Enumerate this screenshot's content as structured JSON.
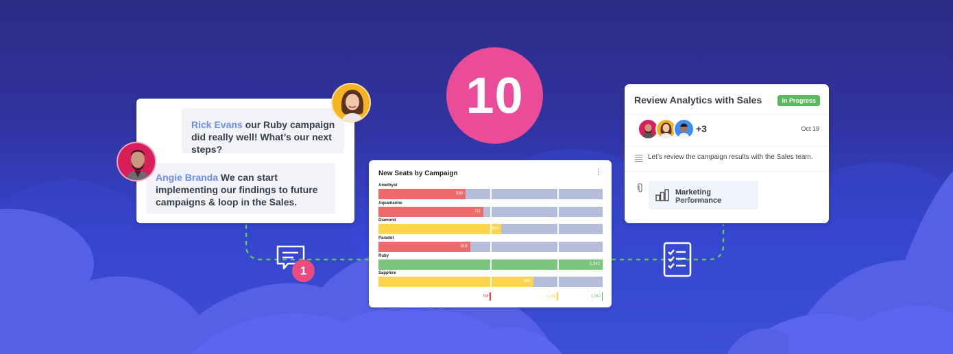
{
  "theme": {
    "bg_top": "#2c2c85",
    "bg_bottom": "#4656e4",
    "accent_pink": "#ea4c98",
    "connector_green": "#5bc85a",
    "status_green": "#5cb85c",
    "link_blue": "#6b8cf0"
  },
  "badge": {
    "number": "10"
  },
  "chat": {
    "messages": [
      {
        "author": "Rick Evans",
        "text": "our Ruby campaign did really well! What’s our next steps?",
        "avatar": "woman-avatar"
      },
      {
        "author": "Angie Branda",
        "text": "We can start implementing our findings to future campaigns & loop in the Sales.",
        "avatar": "man-avatar"
      }
    ],
    "unread_count": "1"
  },
  "chart_data": {
    "type": "bar",
    "orientation": "horizontal",
    "title": "New Seats by Campaign",
    "categories": [
      "Amethyst",
      "Aquamarine",
      "Diamond",
      "Paradot",
      "Ruby",
      "Sapphire"
    ],
    "values": [
      590,
      711,
      814,
      619,
      1342,
      980
    ],
    "value_labels": [
      "590",
      "711",
      "814",
      "619",
      "1,342",
      "980"
    ],
    "bar_colors": [
      "#ec6a6a",
      "#ec6a6a",
      "#ffd44d",
      "#ec6a6a",
      "#7cc57f",
      "#ffd44d"
    ],
    "track_color": "#b4bddc",
    "thresholds": [
      {
        "value": 758,
        "label": "758",
        "color": "#ea3a3a"
      },
      {
        "value": 1106,
        "label": "1,106",
        "color": "#ffcc33"
      },
      {
        "value": 1342,
        "label": "1,342",
        "color": "#5bb85e"
      }
    ],
    "xlim": [
      0,
      1342
    ],
    "grid": true,
    "legend": "none",
    "xlabel": "",
    "ylabel": ""
  },
  "task": {
    "title": "Review Analytics with Sales",
    "status": "In Progress",
    "extra_assignees": "+3",
    "date": "Oct 19",
    "description": "Let’s review the campaign results with the Sales team.",
    "attachment": {
      "title": "Marketing Performance",
      "subtitle": "Dashboard"
    }
  }
}
